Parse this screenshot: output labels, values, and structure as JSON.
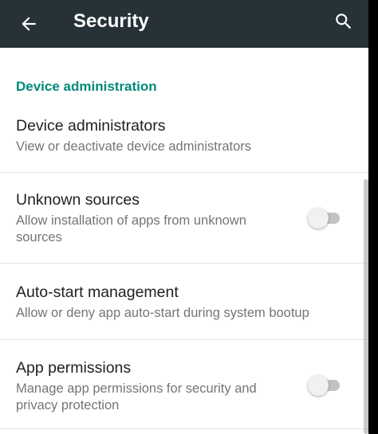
{
  "toolbar": {
    "title": "Security",
    "back_icon": "arrow-back-icon",
    "search_icon": "search-icon",
    "background": "#263238"
  },
  "category": {
    "label": "Device administration",
    "color": "#00897b"
  },
  "preferences": [
    {
      "title": "Device administrators",
      "summary": "View or deactivate device administrators"
    },
    {
      "title": "Unknown sources",
      "summary": "Allow installation of apps from unknown sources",
      "toggle": "off"
    },
    {
      "title": "Auto-start management",
      "summary": "Allow or deny app auto-start during system bootup"
    },
    {
      "title": "App permissions",
      "summary": "Manage app permissions for security and privacy protection",
      "toggle": "off"
    }
  ]
}
